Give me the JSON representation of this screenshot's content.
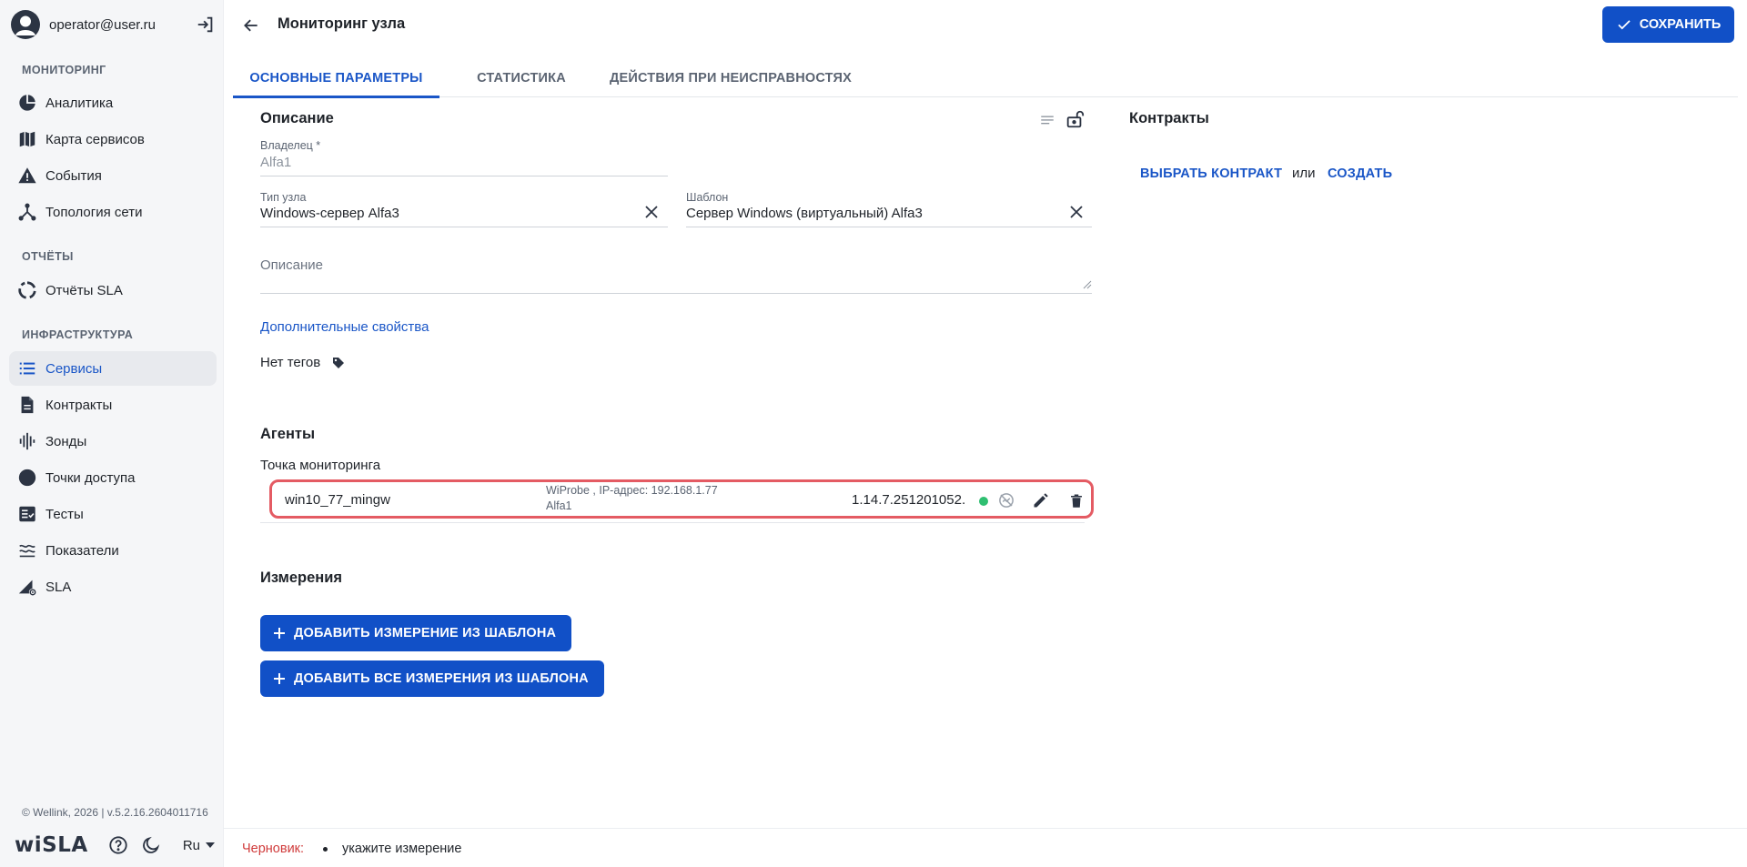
{
  "sidebar": {
    "user_email": "operator@user.ru",
    "sections": {
      "monitoring": "МОНИТОРИНГ",
      "reports": "ОТЧЁТЫ",
      "infrastructure": "ИНФРАСТРУКТУРА"
    },
    "items": [
      {
        "label": "Аналитика",
        "icon": "pie-chart-icon"
      },
      {
        "label": "Карта сервисов",
        "icon": "map-icon"
      },
      {
        "label": "События",
        "icon": "warning-icon"
      },
      {
        "label": "Топология сети",
        "icon": "topology-icon"
      },
      {
        "label": "Отчёты SLA",
        "icon": "circle-progress-icon"
      },
      {
        "label": "Сервисы",
        "icon": "list-icon",
        "active": true
      },
      {
        "label": "Контракты",
        "icon": "document-icon"
      },
      {
        "label": "Зонды",
        "icon": "probe-icon"
      },
      {
        "label": "Точки доступа",
        "icon": "dot-icon"
      },
      {
        "label": "Тесты",
        "icon": "checklist-icon"
      },
      {
        "label": "Показатели",
        "icon": "metrics-icon"
      },
      {
        "label": "SLA",
        "icon": "sla-icon"
      }
    ],
    "copyright": "© Wellink, 2026 | v.5.2.16.2604011716",
    "logo": "wiSLA",
    "language": "Ru"
  },
  "header": {
    "title": "Мониторинг узла",
    "save_label": "СОХРАНИТЬ"
  },
  "tabs": [
    {
      "label": "ОСНОВНЫЕ ПАРАМЕТРЫ",
      "active": true
    },
    {
      "label": "СТАТИСТИКА"
    },
    {
      "label": "ДЕЙСТВИЯ ПРИ НЕИСПРАВНОСТЯХ"
    }
  ],
  "description_section": {
    "title": "Описание",
    "owner_label": "Владелец *",
    "owner_value": "Alfa1",
    "node_type_label": "Тип узла",
    "node_type_value": "Windows-сервер Alfa3",
    "template_label": "Шаблон",
    "template_value": "Сервер Windows (виртуальный) Alfa3",
    "description_placeholder": "Описание",
    "extra_props_link": "Дополнительные свойства",
    "tags_text": "Нет тегов"
  },
  "contracts_section": {
    "title": "Контракты",
    "select_label": "ВЫБРАТЬ КОНТРАКТ",
    "or_text": "или",
    "create_label": "СОЗДАТЬ"
  },
  "agents_section": {
    "title": "Агенты",
    "monitoring_point_label": "Точка мониторинга",
    "agent": {
      "name": "win10_77_mingw",
      "meta_line1": "WiProbe , IP-адрес: 192.168.1.77",
      "meta_line2": "Alfa1",
      "version": "1.14.7.251201052...",
      "status_color": "#2fbf71"
    }
  },
  "measurements_section": {
    "title": "Измерения",
    "add_from_template": "ДОБАВИТЬ ИЗМЕРЕНИЕ ИЗ ШАБЛОНА",
    "add_all_from_template": "ДОБАВИТЬ ВСЕ ИЗМЕРЕНИЯ ИЗ ШАБЛОНА"
  },
  "footer": {
    "draft_label": "Черновик:",
    "draft_message": "укажите измерение"
  },
  "colors": {
    "accent": "#1a56c7",
    "primary_button": "#1150c7",
    "highlight_border": "#e45b63",
    "draft_red": "#d03b3b"
  }
}
